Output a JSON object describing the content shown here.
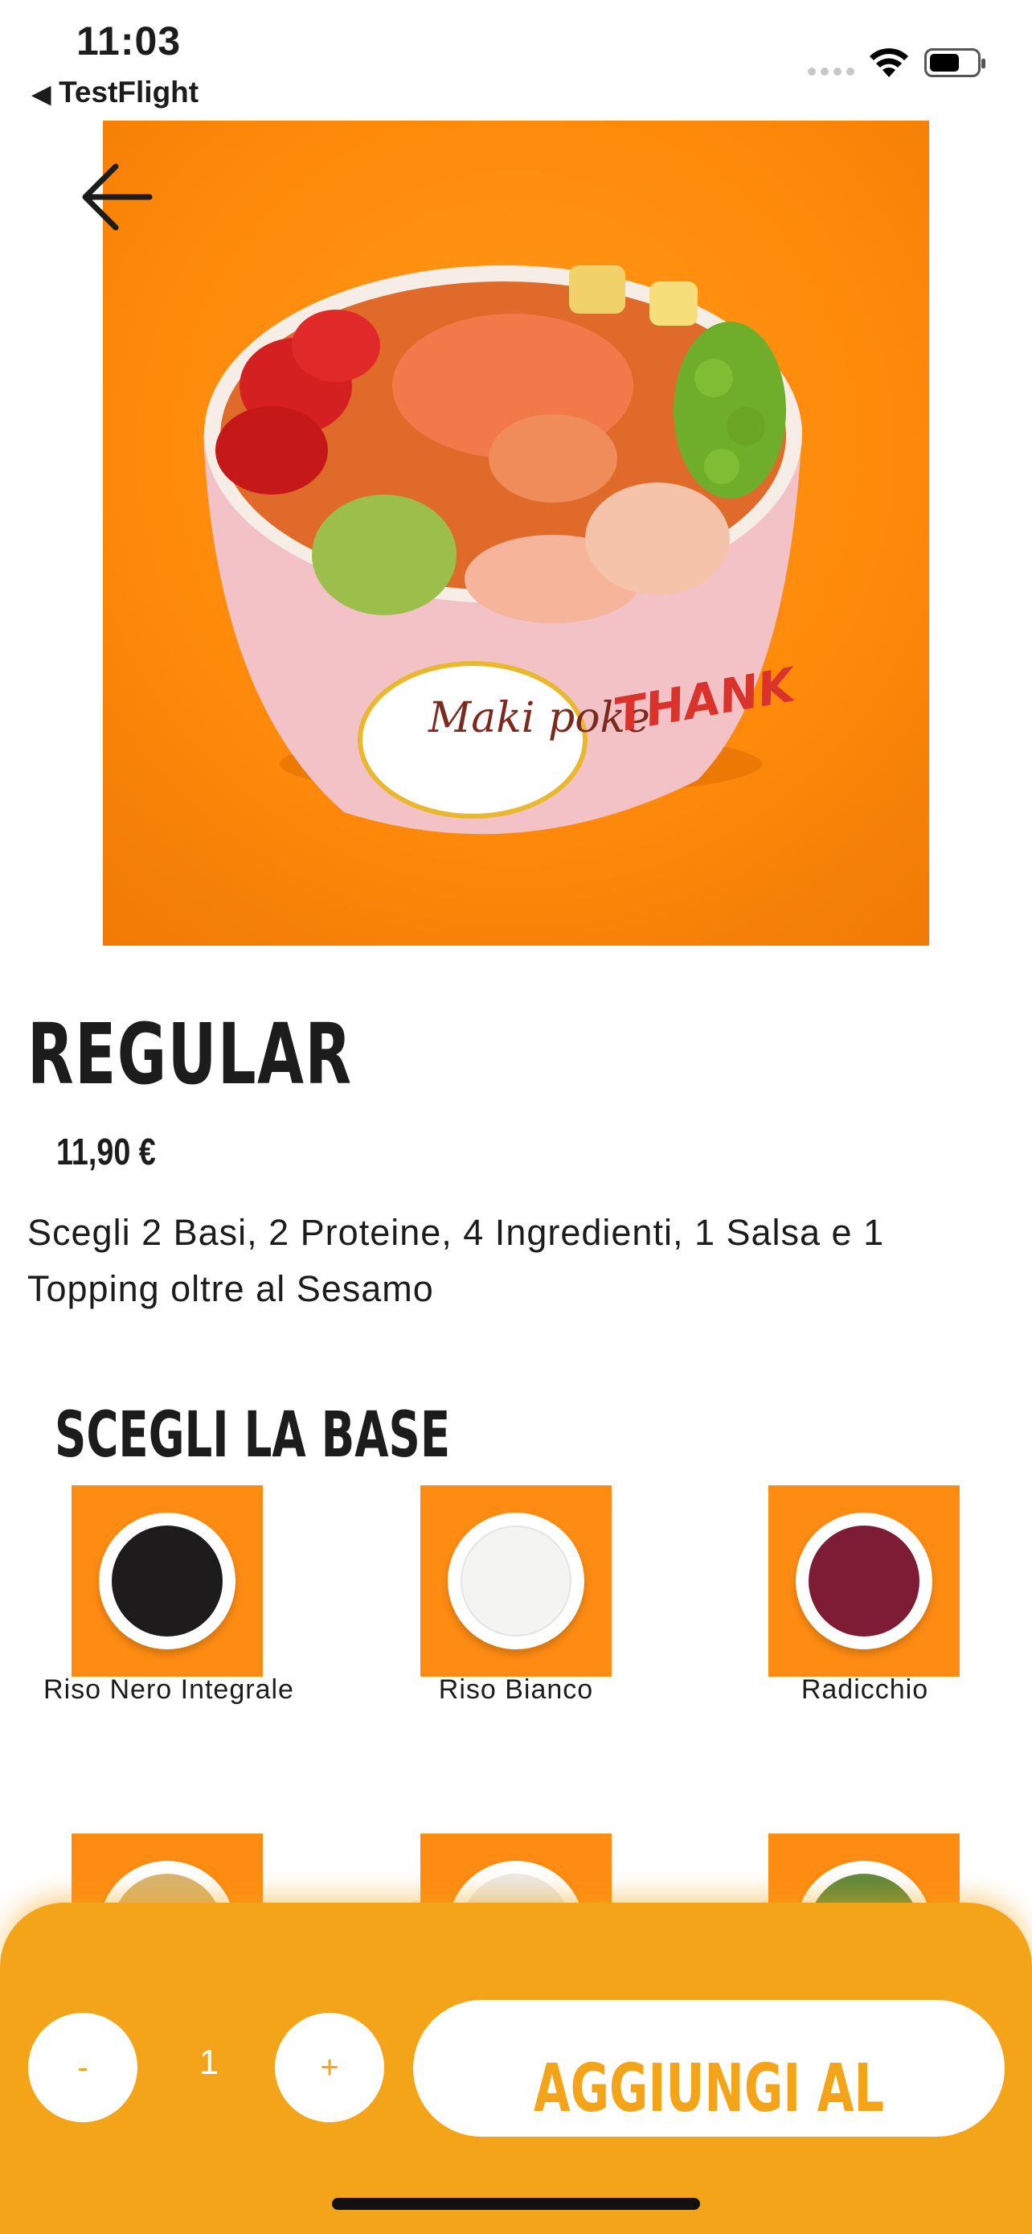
{
  "status_bar": {
    "time": "11:03",
    "back_app": "TestFlight"
  },
  "product": {
    "title": "REGULAR",
    "price": "11,90 €",
    "description": "Scegli 2 Basi, 2 Proteine, 4 Ingredienti, 1 Salsa e 1 Topping oltre al Sesamo",
    "image_brand_text": "Maki poke",
    "image_side_text": "THANK"
  },
  "section": {
    "title": "SCEGLI LA BASE"
  },
  "bases": [
    {
      "label": "Riso Nero Integrale",
      "color": "#1e1b1d"
    },
    {
      "label": "Riso Bianco",
      "color": "#f4f4f2"
    },
    {
      "label": "Radicchio",
      "color": "#7e1b35"
    }
  ],
  "bases_row2_colors": [
    "#d8b470",
    "#ece9e2",
    "#5e8a3c"
  ],
  "cart": {
    "minus": "-",
    "quantity": "1",
    "plus": "+",
    "add_label": "AGGIUNGI AL L'ORDINE"
  },
  "colors": {
    "accent": "#f4a418",
    "hero_bg": "#ff8c12"
  }
}
